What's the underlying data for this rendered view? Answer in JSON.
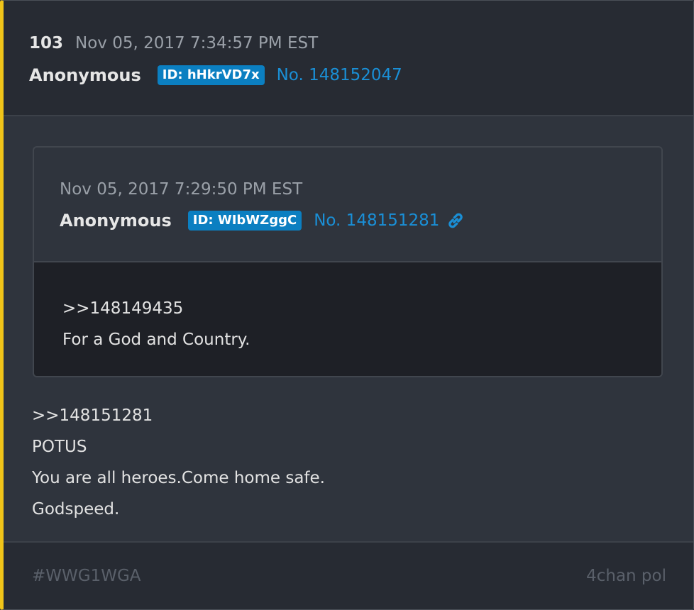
{
  "post": {
    "number": "103",
    "timestamp": "Nov 05, 2017 7:34:57 PM EST",
    "author": "Anonymous",
    "id_badge": "ID: hHkrVD7x",
    "post_no": "No. 148152047"
  },
  "quoted": {
    "timestamp": "Nov 05, 2017 7:29:50 PM EST",
    "author": "Anonymous",
    "id_badge": "ID: WIbWZggC",
    "post_no": "No. 148151281",
    "link_icon": "link-icon",
    "lines": [
      ">>148149435",
      "For a God and Country."
    ]
  },
  "body": {
    "lines": [
      ">>148151281",
      "POTUS",
      "You are all heroes.Come home safe.",
      "Godspeed."
    ]
  },
  "footer": {
    "tag": "#WWG1WGA",
    "source": "4chan pol"
  },
  "colors": {
    "accent_bar": "#f0c419",
    "badge": "#0b7fc1",
    "link": "#1a8fd6"
  }
}
